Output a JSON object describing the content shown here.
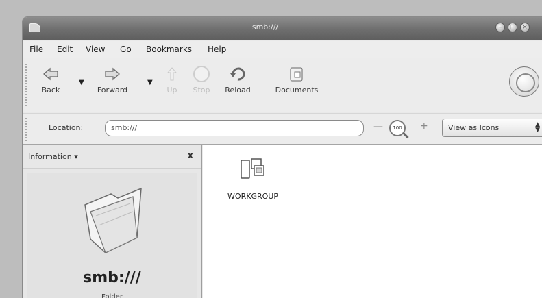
{
  "window": {
    "title": "smb:///"
  },
  "menubar": {
    "items": [
      {
        "label": "File",
        "mnemonic": "F",
        "rest": "ile"
      },
      {
        "label": "Edit",
        "mnemonic": "E",
        "rest": "dit"
      },
      {
        "label": "View",
        "mnemonic": "V",
        "rest": "iew"
      },
      {
        "label": "Go",
        "mnemonic": "G",
        "rest": "o"
      },
      {
        "label": "Bookmarks",
        "mnemonic": "B",
        "rest": "ookmarks"
      },
      {
        "label": "Help",
        "mnemonic": "H",
        "rest": "elp"
      }
    ]
  },
  "toolbar": {
    "back": "Back",
    "forward": "Forward",
    "up": "Up",
    "stop": "Stop",
    "reload": "Reload",
    "documents": "Documents"
  },
  "locationbar": {
    "label": "Location:",
    "value": "smb:///",
    "zoom_level": "100",
    "view_mode": "View as Icons"
  },
  "sidebar": {
    "title": "Information",
    "location_name": "smb:///",
    "location_type": "Folder"
  },
  "content": {
    "items": [
      {
        "name": "WORKGROUP",
        "icon": "network-workgroup-icon"
      }
    ]
  },
  "colors": {
    "content_bg": "#ffffff",
    "titlebar": "#6e6e6e",
    "chrome": "#ececec"
  }
}
